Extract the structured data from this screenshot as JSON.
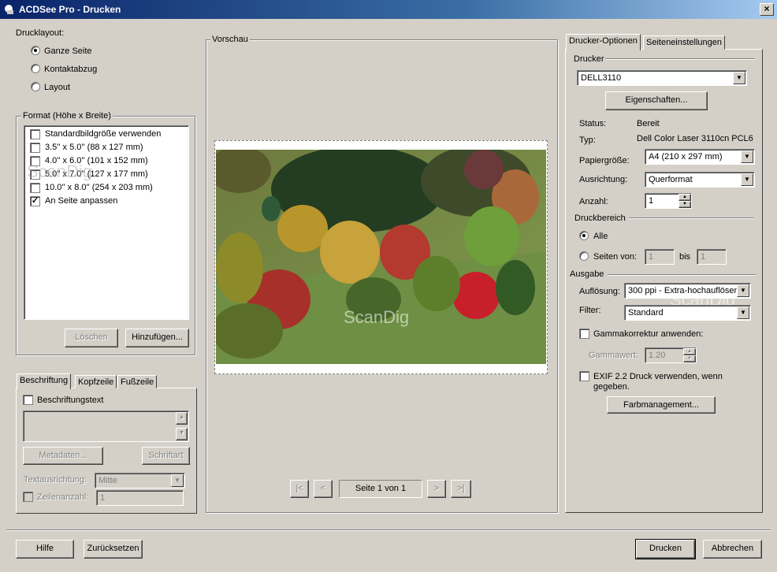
{
  "window": {
    "title": "ACDSee Pro - Drucken",
    "close": "×"
  },
  "layout": {
    "label": "Drucklayout:",
    "options": [
      "Ganze Seite",
      "Kontaktabzug",
      "Layout"
    ],
    "selected": 0
  },
  "format": {
    "label": "Format (Höhe x Breite)",
    "items": [
      {
        "label": "Standardbildgröße verwenden",
        "checked": false
      },
      {
        "label": "3.5'' x 5.0'' (88 x 127 mm)",
        "checked": false
      },
      {
        "label": "4.0'' x 6.0'' (101 x 152 mm)",
        "checked": false
      },
      {
        "label": "5.0'' x 7.0'' (127 x 177 mm)",
        "checked": false
      },
      {
        "label": "10.0'' x 8.0'' (254 x 203 mm)",
        "checked": false
      },
      {
        "label": "An Seite anpassen",
        "checked": true
      }
    ],
    "delete": "Löschen",
    "add": "Hinzufügen..."
  },
  "caption": {
    "tabs": [
      "Beschriftung",
      "Kopfzeile",
      "Fußzeile"
    ],
    "text_check": "Beschriftungstext",
    "metadata": "Metadaten...",
    "font": "Schriftart",
    "align_label": "Textausrichtung:",
    "align_value": "Mitte",
    "lines_label": "Zeilenanzahl:",
    "lines_value": "1"
  },
  "preview": {
    "label": "Vorschau",
    "watermark": "ScanDig",
    "nav": {
      "first": "|<",
      "prev": "<",
      "page": "Seite 1 von 1",
      "next": ">",
      "last": ">|"
    }
  },
  "options": {
    "tabs": [
      "Drucker-Optionen",
      "Seiteneinstellungen"
    ],
    "printer_group": "Drucker",
    "printer": "DELL3110",
    "properties": "Eigenschaften...",
    "status_label": "Status:",
    "status_value": "Bereit",
    "type_label": "Typ:",
    "type_value": "Dell Color Laser 3110cn PCL6",
    "paper_label": "Papiergröße:",
    "paper_value": "A4 (210 x 297 mm)",
    "orient_label": "Ausrichtung:",
    "orient_value": "Querformat",
    "count_label": "Anzahl:",
    "count_value": "1",
    "range_group": "Druckbereich",
    "range_all": "Alle",
    "range_pages": "Seiten von:",
    "range_from": "1",
    "range_to_label": "bis",
    "range_to": "1",
    "output_group": "Ausgabe",
    "res_label": "Auflösung:",
    "res_value": "300 ppi - Extra-hochauflösend",
    "filter_label": "Filter:",
    "filter_value": "Standard",
    "gamma_check": "Gammakorrektur anwenden:",
    "gamma_label": "Gammawert:",
    "gamma_value": "1.20",
    "exif_check": "EXIF 2.2 Druck verwenden, wenn gegeben.",
    "color_mgmt": "Farbmanagement...",
    "watermark": "ScanDig"
  },
  "footer": {
    "help": "Hilfe",
    "reset": "Zurücksetzen",
    "print": "Drucken",
    "cancel": "Abbrechen"
  },
  "colors": {
    "titlebar": "#0a246a",
    "face": "#d4d0c8"
  }
}
